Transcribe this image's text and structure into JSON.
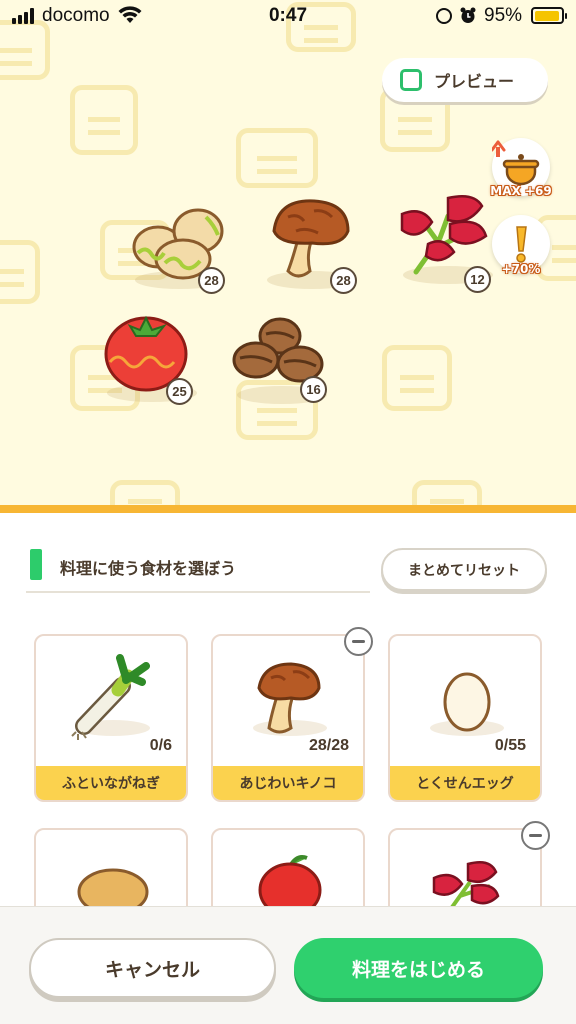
{
  "status_bar": {
    "carrier": "docomo",
    "time": "0:47",
    "battery_percent": "95%",
    "battery_level": 0.95
  },
  "preview": {
    "label": "プレビュー",
    "checked": false
  },
  "bonuses": [
    {
      "name": "pot-capacity",
      "label": "MAX +69"
    },
    {
      "name": "success-rate",
      "label": "+70%"
    }
  ],
  "pot_ingredients": [
    {
      "name": "soybeans",
      "count": "28"
    },
    {
      "name": "mushroom",
      "count": "28"
    },
    {
      "name": "herb",
      "count": "12"
    },
    {
      "name": "tomato",
      "count": "25"
    },
    {
      "name": "cacao",
      "count": "16"
    }
  ],
  "selector": {
    "title": "料理に使う食材を選ぼう",
    "reset_label": "まとめてリセット"
  },
  "ingredient_cards": [
    {
      "name": "ふといながねぎ",
      "count": "0/6",
      "removable": false
    },
    {
      "name": "あじわいキノコ",
      "count": "28/28",
      "removable": true
    },
    {
      "name": "とくせんエッグ",
      "count": "0/55",
      "removable": false
    },
    {
      "name": "potato",
      "count": "",
      "removable": false
    },
    {
      "name": "apple",
      "count": "",
      "removable": false
    },
    {
      "name": "herb",
      "count": "",
      "removable": true
    }
  ],
  "actions": {
    "cancel_label": "キャンセル",
    "start_label": "料理をはじめる"
  },
  "colors": {
    "accent_green": "#2fd06e",
    "card_label_yellow": "#fbd24e",
    "pot_background": "#fffbe0",
    "pot_border": "#f7b634"
  }
}
